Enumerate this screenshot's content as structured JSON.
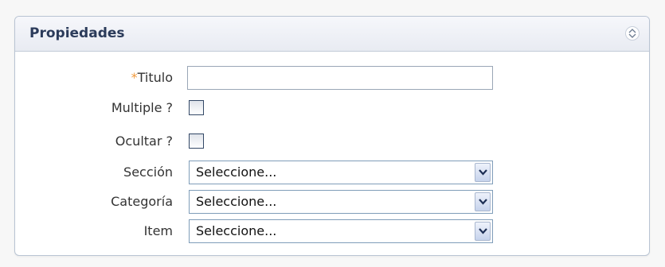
{
  "panel": {
    "title": "Propiedades",
    "collapse_icon": "collapse-toggle-icon"
  },
  "fields": {
    "titulo": {
      "required_mark": "*",
      "label": "Titulo",
      "value": ""
    },
    "multiple": {
      "label": "Multiple ?",
      "checked": false
    },
    "ocultar": {
      "label": "Ocultar ?",
      "checked": false
    },
    "seccion": {
      "label": "Sección",
      "selected": "Seleccione..."
    },
    "categoria": {
      "label": "Categoría",
      "selected": "Seleccione..."
    },
    "item": {
      "label": "Item",
      "selected": "Seleccione..."
    }
  },
  "colors": {
    "required": "#f29a3b",
    "title": "#2b3b5a",
    "header_bg": "#e8ebf2",
    "border": "#b9c4d3"
  }
}
